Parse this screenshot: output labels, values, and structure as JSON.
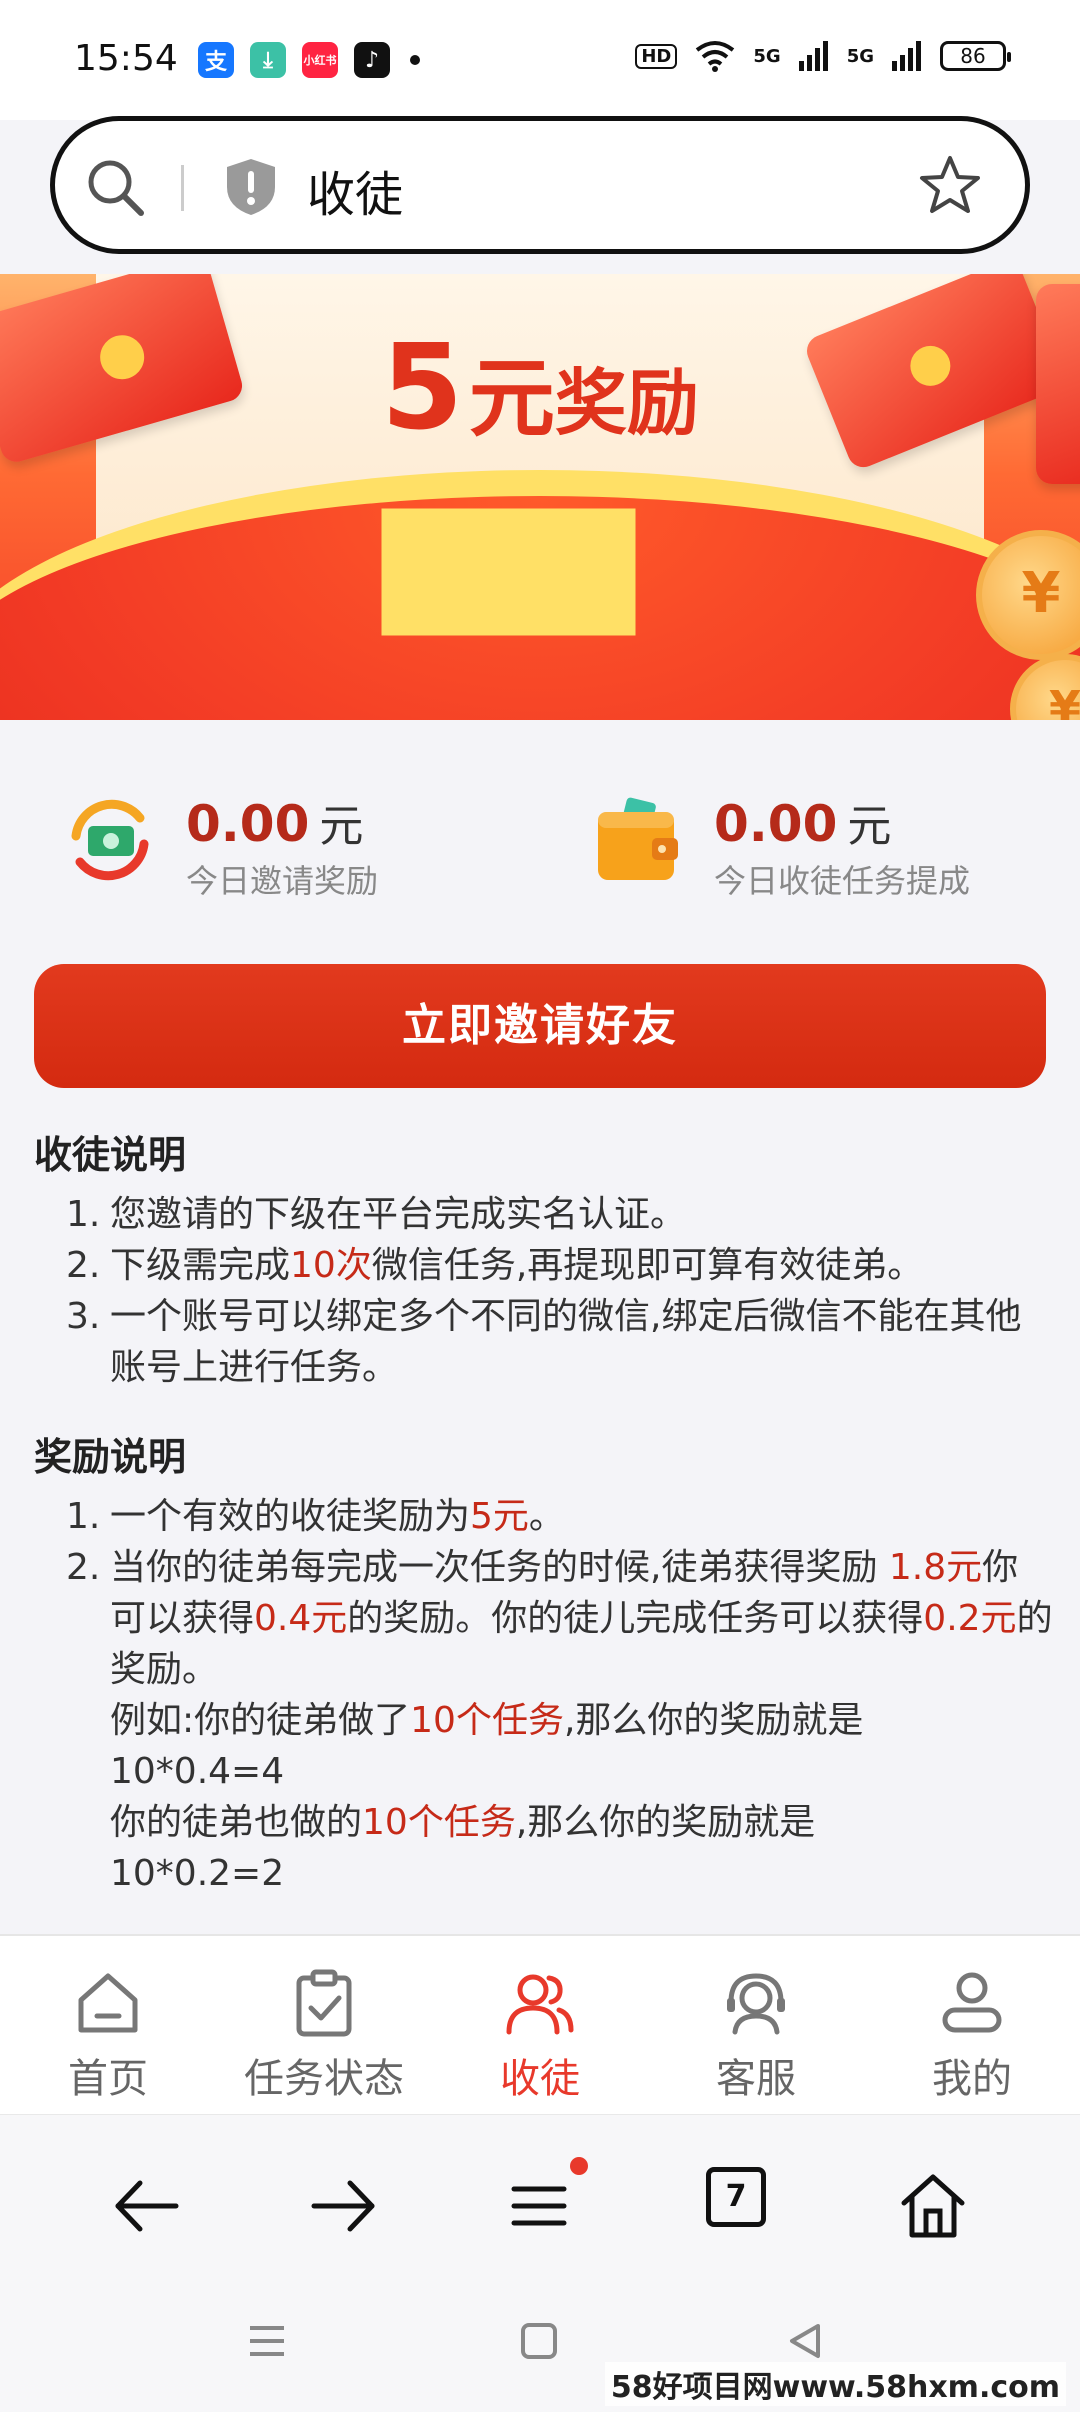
{
  "status_bar": {
    "time": "15:54",
    "apps": [
      "支",
      "⤓",
      "小红书",
      "♪"
    ],
    "hd": "HD",
    "signal_1": "5G",
    "signal_2": "5G",
    "battery": "86"
  },
  "search": {
    "query": "收徒"
  },
  "banner": {
    "amount": "5",
    "unit": "元",
    "text": "奖励"
  },
  "summary": {
    "today_invite_value": "0.00",
    "today_invite_unit": "元",
    "today_invite_label": "今日邀请奖励",
    "today_withdraw_value": "0.00",
    "today_withdraw_unit": "元",
    "today_withdraw_label": "今日收徒任务提成"
  },
  "invite_button": "立即邀请好友",
  "apprentice_rules": {
    "title": "收徒说明",
    "item1": "您邀请的下级在平台完成实名认证。",
    "item2_pre": "下级需完成",
    "item2_hl": "10次",
    "item2_post": "微信任务,再提现即可算有效徒弟。",
    "item3": "一个账号可以绑定多个不同的微信,绑定后微信不能在其他账号上进行任务。"
  },
  "reward_rules": {
    "title": "奖励说明",
    "item1_pre": "一个有效的收徒奖励为",
    "item1_hl": "5元",
    "item1_post": "。",
    "item2_a": "当你的徒弟每完成一次任务的时候,徒弟获得奖励 ",
    "item2_b": "1.8元",
    "item2_c": "你可以获得",
    "item2_d": "0.4元",
    "item2_e": "的奖励。你的徒儿完成任务可以获得",
    "item2_f": "0.2元",
    "item2_g": "的奖励。",
    "ex1_pre": "例如:你的徒弟做了",
    "ex1_hl": "10个任务",
    "ex1_post": ",那么你的奖励就是",
    "ex1_formula": "10*0.4=4",
    "ex2_pre": "你的徒弟也做的",
    "ex2_hl": "10个任务",
    "ex2_post": ",那么你的奖励就是",
    "ex2_formula": "10*0.2=2"
  },
  "tabbar": {
    "home": "首页",
    "task_status": "任务状态",
    "apprentice": "收徒",
    "service": "客服",
    "mine": "我的"
  },
  "browser_bar": {
    "tab_count": "7"
  },
  "watermark": "58好项目网www.58hxm.com",
  "colors": {
    "accent": "#d42a10",
    "highlight": "#c62a18",
    "active_tab": "#e8392b"
  }
}
